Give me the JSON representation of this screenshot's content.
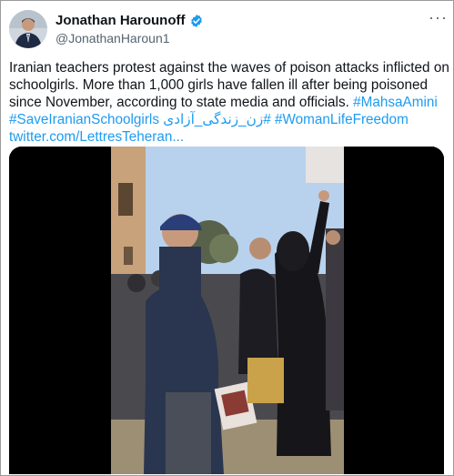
{
  "author": {
    "display_name": "Jonathan Harounoff",
    "handle": "@JonathanHaroun1",
    "verified": true
  },
  "more_icon": "more-horizontal-icon",
  "tweet": {
    "line1": "Iranian teachers protest against the waves of poison attacks inflicted on",
    "line2": "schoolgirls. More than 1,000 girls have fallen ill after being poisoned",
    "line3_text": "since November, according to state media and officials. ",
    "hashtag1": "#MahsaAmini",
    "hashtag2": "#SaveIranianSchoolgirls",
    "hashtag3": "#زن_زندگی_آزادی",
    "hashtag4": "#WomanLifeFreedom",
    "link": "twitter.com/LettresTeheran..."
  },
  "colors": {
    "link": "#1d9bf0",
    "verified": "#1d9bf0",
    "handle": "#536471"
  }
}
